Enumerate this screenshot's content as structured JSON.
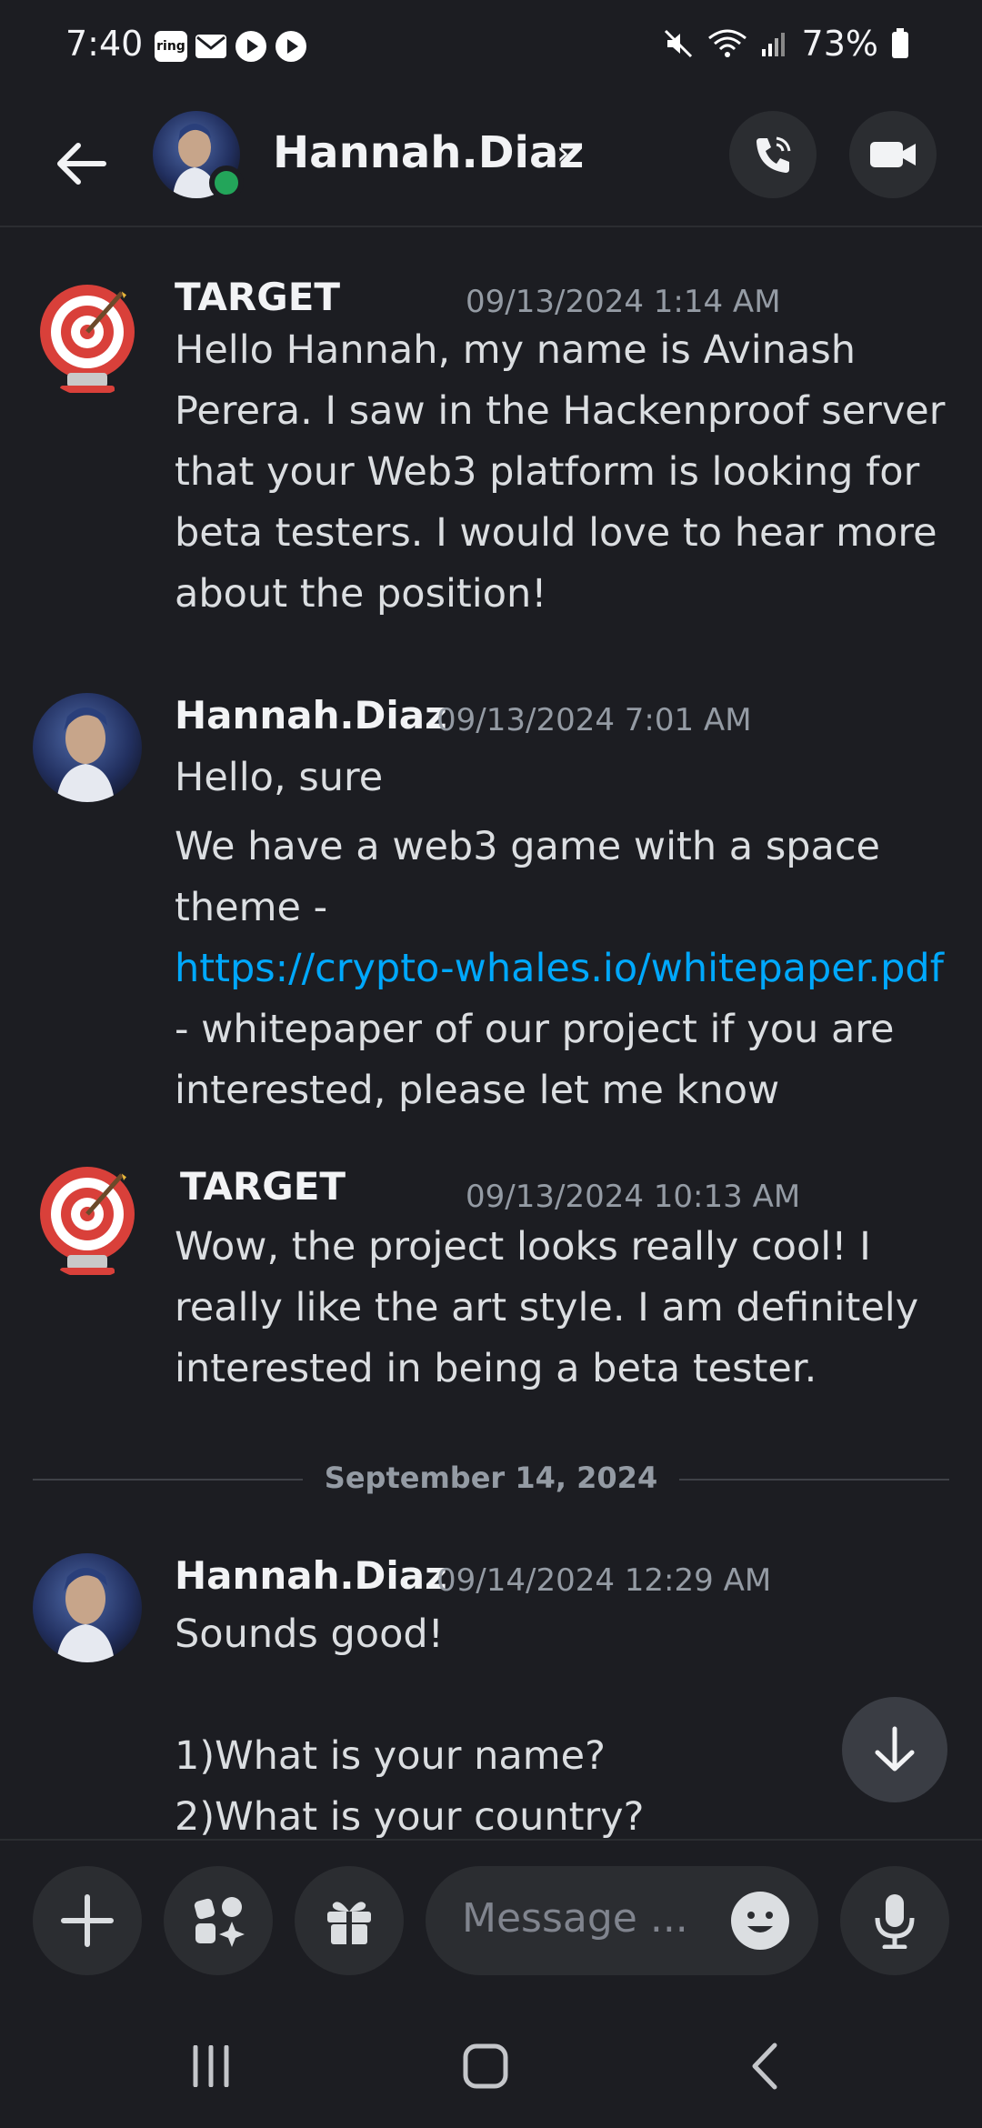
{
  "status_bar": {
    "time": "7:40",
    "ring_label": "ring",
    "battery": "73%"
  },
  "header": {
    "name": "Hannah.Diaz",
    "chevron": "›"
  },
  "messages": [
    {
      "author": "TARGET",
      "time": "09/13/2024 1:14 AM",
      "lines": [
        "Hello Hannah, my name is Avinash Perera. I saw in the Hackenproof server that your Web3 platform is looking for beta testers. I would love to hear more about the position!"
      ]
    },
    {
      "author": "Hannah.Diaz",
      "time": "09/13/2024 7:01 AM",
      "line1": "Hello, sure",
      "line2_pre": "We have a web3 game with a space theme -",
      "link": "https://crypto-whales.io/whitepaper.pdf",
      "line2_post": "- whitepaper of our project if you are interested, please let me know"
    },
    {
      "author": "TARGET",
      "time": "09/13/2024 10:13 AM",
      "text": "Wow, the project looks really cool! I really like the art style. I am definitely interested in being a beta tester."
    },
    {
      "author": "Hannah.Diaz",
      "time": "09/14/2024 12:29 AM",
      "line1": "Sounds good!",
      "q1": "1)What is your name?",
      "q2": "2)What is your country?"
    }
  ],
  "date_divider": "September 14, 2024",
  "composer": {
    "placeholder": "Message ..."
  },
  "colors": {
    "background": "#1c1d22",
    "link": "#00a8fc",
    "online": "#23a55a",
    "target_red": "#d9403a"
  }
}
